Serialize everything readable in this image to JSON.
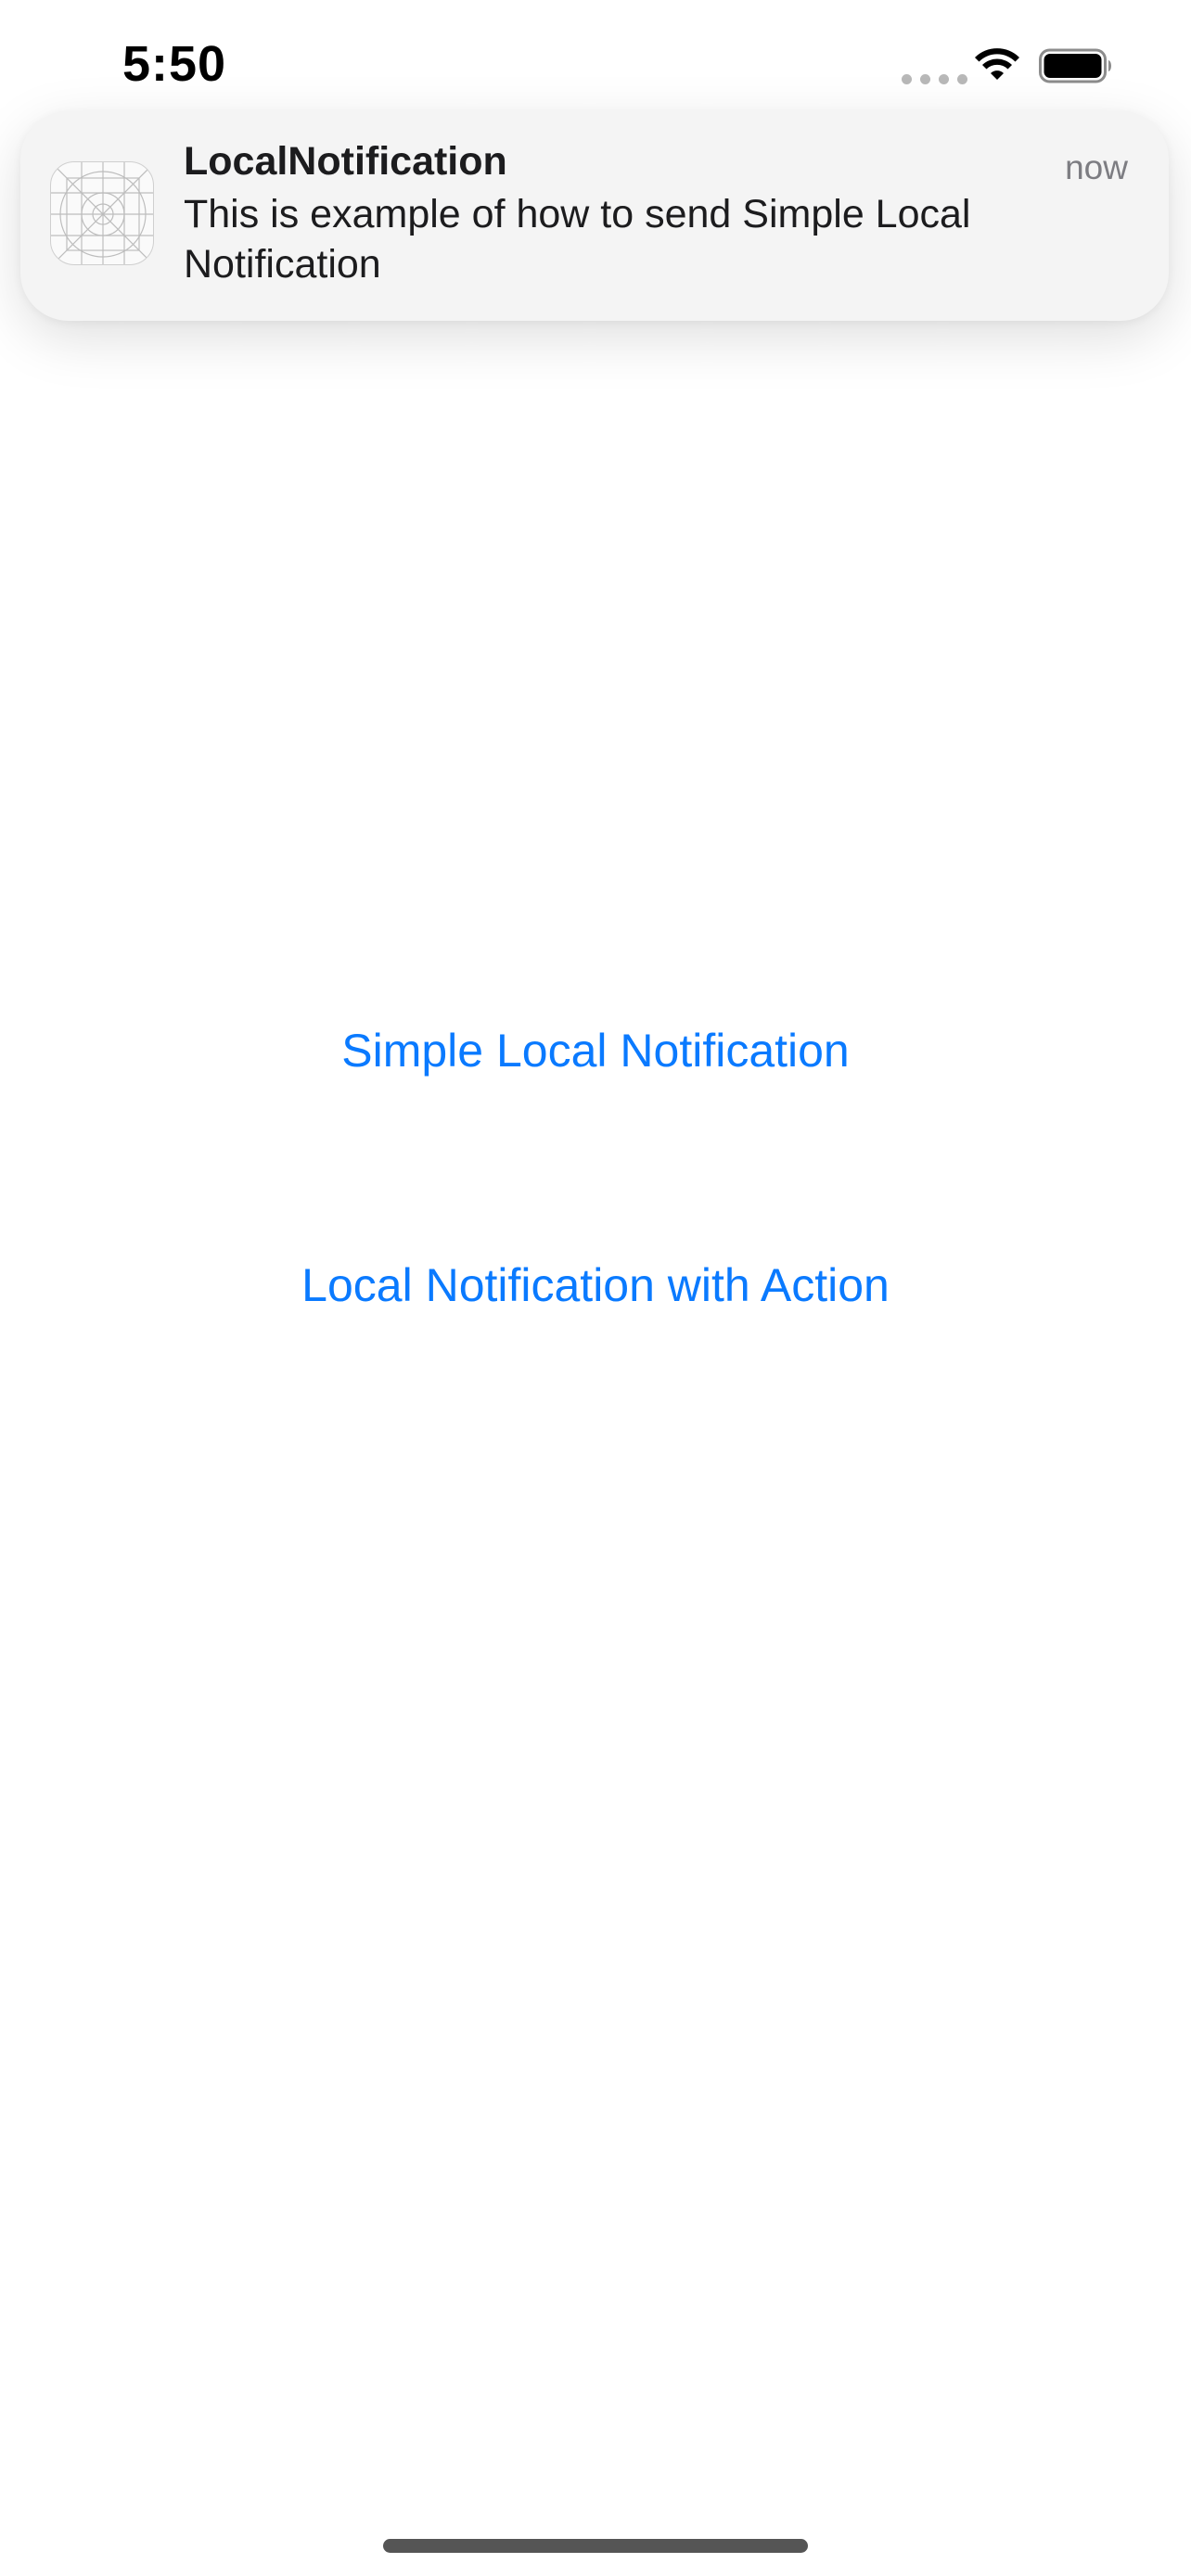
{
  "status_bar": {
    "time": "5:50",
    "icons": [
      "signal-dots-icon",
      "wifi-icon",
      "battery-icon"
    ]
  },
  "notification": {
    "app_name": "LocalNotification",
    "time": "now",
    "body": "This is example of how to send Simple Local Notification",
    "icon": "app-placeholder-icon"
  },
  "main": {
    "simple_button_label": "Simple Local Notification",
    "action_button_label": "Local Notification with Action"
  },
  "colors": {
    "accent": "#0a7aff",
    "notification_background": "#f4f4f4",
    "text_primary": "#1c1c1e",
    "text_secondary": "#7d7d82"
  }
}
